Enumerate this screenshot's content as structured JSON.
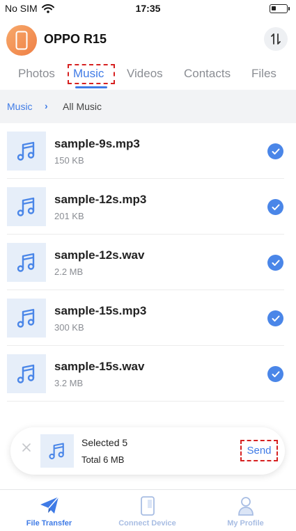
{
  "status_bar": {
    "carrier": "No SIM",
    "time": "17:35",
    "battery_fraction": 0.3
  },
  "device": {
    "name": "OPPO R15"
  },
  "tabs": [
    {
      "label": "Photos",
      "active": false
    },
    {
      "label": "Music",
      "active": true
    },
    {
      "label": "Videos",
      "active": false
    },
    {
      "label": "Contacts",
      "active": false
    },
    {
      "label": "Files",
      "active": false
    }
  ],
  "breadcrumb": {
    "root": "Music",
    "current": "All Music"
  },
  "files": [
    {
      "name": "sample-9s.mp3",
      "size": "150 KB",
      "selected": true
    },
    {
      "name": "sample-12s.mp3",
      "size": "201 KB",
      "selected": true
    },
    {
      "name": "sample-12s.wav",
      "size": "2.2 MB",
      "selected": true
    },
    {
      "name": "sample-15s.mp3",
      "size": "300 KB",
      "selected": true
    },
    {
      "name": "sample-15s.wav",
      "size": "3.2 MB",
      "selected": true
    }
  ],
  "selection": {
    "count_label": "Selected 5",
    "total_label": "Total 6 MB",
    "send_label": "Send"
  },
  "bottom_nav": [
    {
      "label": "File Transfer",
      "icon": "paper-plane-icon",
      "active": true
    },
    {
      "label": "Connect Device",
      "icon": "phone-device-icon",
      "active": false
    },
    {
      "label": "My Profile",
      "icon": "person-icon",
      "active": false
    }
  ],
  "colors": {
    "accent": "#3f7be6",
    "check": "#4a86e8",
    "highlight": "#d62020",
    "avatar": "#ef7f45",
    "thumb_bg": "#e6eef9"
  }
}
